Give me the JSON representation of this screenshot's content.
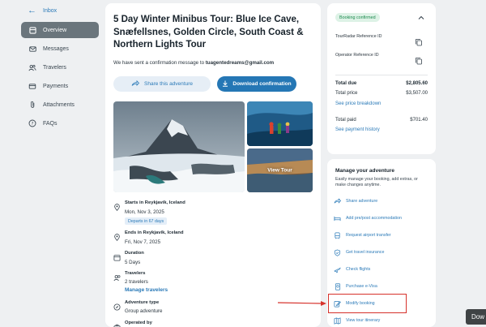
{
  "sidebar": {
    "back_label": "Inbox",
    "items": [
      {
        "label": "Overview",
        "icon": "overview-icon",
        "active": true
      },
      {
        "label": "Messages",
        "icon": "mail-icon",
        "active": false
      },
      {
        "label": "Travelers",
        "icon": "people-icon",
        "active": false
      },
      {
        "label": "Payments",
        "icon": "card-icon",
        "active": false
      },
      {
        "label": "Attachments",
        "icon": "paperclip-icon",
        "active": false
      },
      {
        "label": "FAQs",
        "icon": "question-icon",
        "active": false
      }
    ]
  },
  "tour": {
    "title": "5 Day Winter Minibus Tour: Blue Ice Cave, Snæfellsnes, Golden Circle, South Coast & Northern Lights Tour",
    "confirmation_prefix": "We have sent a confirmation message to ",
    "confirmation_email": "tuagentedreams@gmail.com",
    "share_label": "Share this adventure",
    "download_label": "Download confirmation",
    "view_tour_label": "View Tour"
  },
  "details": {
    "start": {
      "label": "Starts in Reykjavík, Iceland",
      "date": "Mon, Nov 3, 2025",
      "chip": "Departs in 67 days"
    },
    "end": {
      "label": "Ends in Reykjavík, Iceland",
      "date": "Fri, Nov 7, 2025"
    },
    "duration": {
      "label": "Duration",
      "value": "5 Days"
    },
    "travelers": {
      "label": "Travelers",
      "value": "2 travelers",
      "link": "Manage travelers"
    },
    "adventure_type": {
      "label": "Adventure type",
      "value": "Group adventure"
    },
    "operated_by": {
      "label": "Operated by"
    }
  },
  "booking": {
    "status_badge": "Booking confirmed",
    "tourradar_ref_label": "TourRadar Reference ID",
    "operator_ref_label": "Operator Reference ID",
    "total_due_label": "Total due",
    "total_due_value": "$2,805.60",
    "total_price_label": "Total price",
    "total_price_value": "$3,507.00",
    "price_breakdown_link": "See price breakdown",
    "total_paid_label": "Total paid",
    "total_paid_value": "$701.40",
    "payment_history_link": "See payment history"
  },
  "manage": {
    "title": "Manage your adventure",
    "description": "Easily manage your booking, add extras, or make changes anytime.",
    "actions": [
      {
        "label": "Share adventure",
        "icon": "share-icon"
      },
      {
        "label": "Add pre/post accommodation",
        "icon": "bed-icon"
      },
      {
        "label": "Request airport transfer",
        "icon": "bus-icon"
      },
      {
        "label": "Get travel insurance",
        "icon": "shield-icon"
      },
      {
        "label": "Check flights",
        "icon": "plane-icon"
      },
      {
        "label": "Purchase e-Visa",
        "icon": "passport-icon"
      },
      {
        "label": "Modify booking",
        "icon": "edit-icon"
      },
      {
        "label": "View tour itinerary",
        "icon": "map-icon"
      }
    ]
  },
  "overlay": {
    "corner_tag": "Dow"
  },
  "colors": {
    "accent": "#2577b5",
    "link": "#2b7ab8",
    "confirmed_badge": "#ddf2e6",
    "highlight": "#d6312b"
  }
}
